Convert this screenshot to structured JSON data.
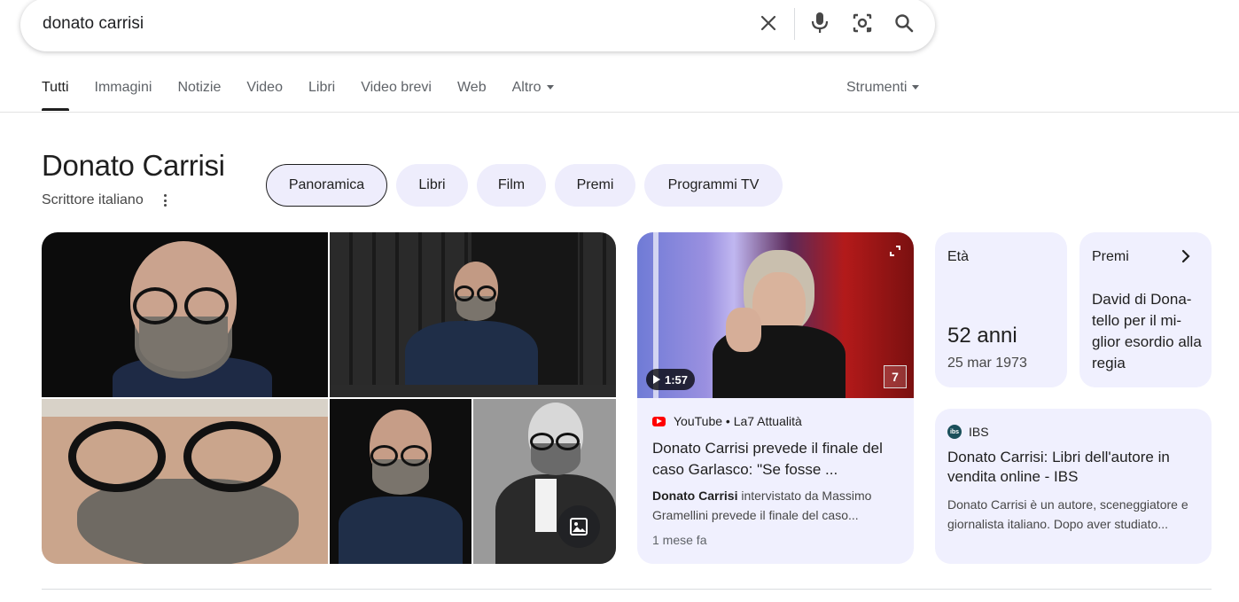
{
  "search": {
    "query": "donato carrisi",
    "clear_icon": "close-icon",
    "voice_icon": "microphone-icon",
    "lens_icon": "camera-lens-icon",
    "search_icon": "search-icon"
  },
  "tabs": [
    {
      "label": "Tutti",
      "active": true
    },
    {
      "label": "Immagini"
    },
    {
      "label": "Notizie"
    },
    {
      "label": "Video"
    },
    {
      "label": "Libri"
    },
    {
      "label": "Video brevi"
    },
    {
      "label": "Web"
    },
    {
      "label": "Altro",
      "has_caret": true
    }
  ],
  "tools_label": "Strumenti",
  "entity": {
    "title": "Donato Carrisi",
    "subtitle": "Scrittore italiano",
    "chips": [
      {
        "label": "Panoramica",
        "selected": true
      },
      {
        "label": "Libri"
      },
      {
        "label": "Film"
      },
      {
        "label": "Premi"
      },
      {
        "label": "Programmi TV"
      }
    ]
  },
  "images_badge_icon": "image-gallery-icon",
  "video": {
    "duration": "1:57",
    "source": "YouTube • La7 Attualità",
    "title": "Donato Carrisi prevede il finale del caso Garlasco: \"Se fosse ...",
    "snippet_bold": "Donato Carrisi",
    "snippet_rest": " intervistato da Massimo Gramellini prevede il finale del caso...",
    "time": "1 mese fa",
    "channel_badge": "7"
  },
  "facts": {
    "age": {
      "label": "Età",
      "value": "52 anni",
      "date": "25 mar 1973"
    },
    "awards": {
      "label": "Premi",
      "text": "David di Dona-tello per il mi-glior esordio alla regia"
    }
  },
  "ibs": {
    "logo_text": "ibs",
    "source": "IBS",
    "title": "Donato Carrisi: Libri dell'autore in vendita online - IBS",
    "snippet": "Donato Carrisi è un autore, sceneggiatore e giornalista italiano. Dopo aver studiato..."
  },
  "colors": {
    "chip_bg": "#eeedfc",
    "card_bg": "#f0f0fe",
    "text": "#1f1f1f",
    "muted": "#5f6368"
  }
}
